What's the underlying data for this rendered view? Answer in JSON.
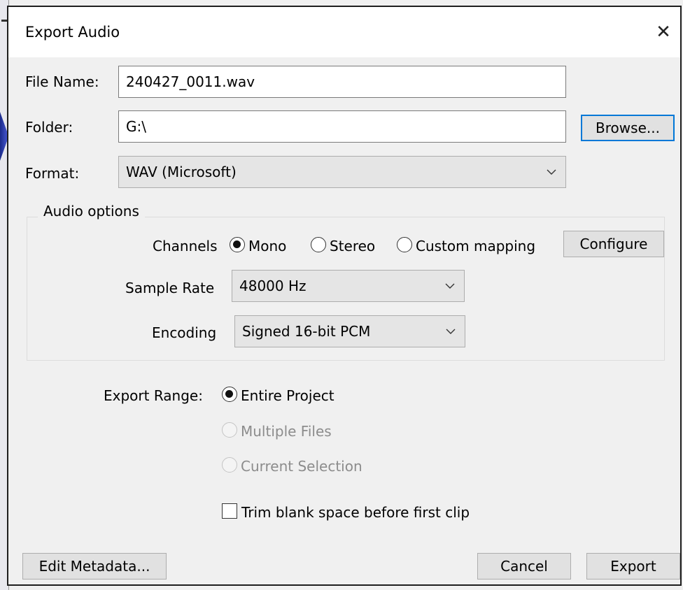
{
  "dialog": {
    "title": "Export Audio",
    "close_glyph": "✕"
  },
  "file_name": {
    "label": "File Name:",
    "value": "240427_0011.wav"
  },
  "folder": {
    "label": "Folder:",
    "value": "G:\\",
    "browse_label": "Browse..."
  },
  "format": {
    "label": "Format:",
    "selected": "WAV (Microsoft)"
  },
  "audio_options": {
    "group_label": "Audio options",
    "channels_label": "Channels",
    "channel_options": [
      {
        "label": "Mono",
        "checked": true
      },
      {
        "label": "Stereo",
        "checked": false
      },
      {
        "label": "Custom mapping",
        "checked": false
      }
    ],
    "configure_label": "Configure",
    "sample_rate_label": "Sample Rate",
    "sample_rate_selected": "48000 Hz",
    "encoding_label": "Encoding",
    "encoding_selected": "Signed 16-bit PCM"
  },
  "export_range": {
    "label": "Export Range:",
    "options": [
      {
        "label": "Entire Project",
        "checked": true,
        "enabled": true
      },
      {
        "label": "Multiple Files",
        "checked": false,
        "enabled": false
      },
      {
        "label": "Current Selection",
        "checked": false,
        "enabled": false
      }
    ]
  },
  "trim": {
    "label": "Trim blank space before first clip",
    "checked": false
  },
  "footer": {
    "edit_metadata_label": "Edit Metadata...",
    "cancel_label": "Cancel",
    "export_label": "Export"
  },
  "colors": {
    "dialog_bg": "#f0f0f0",
    "title_bg": "#ffffff",
    "focus_border": "#0078d7",
    "disabled_text": "#8c8c8c"
  }
}
